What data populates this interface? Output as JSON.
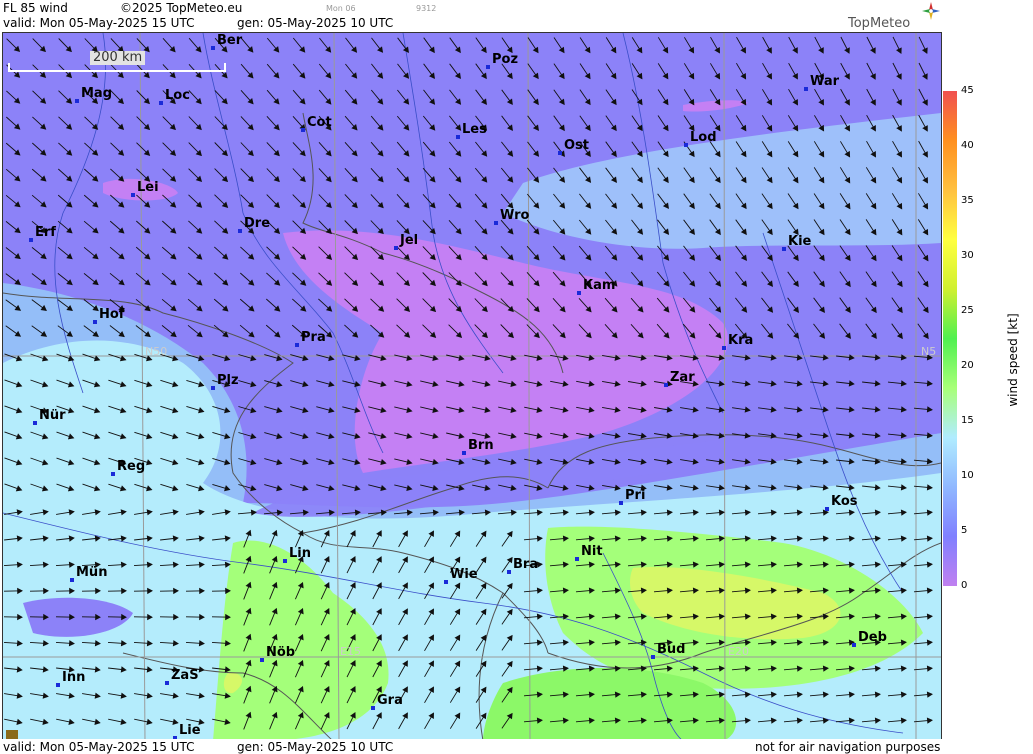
{
  "header": {
    "product": "FL 85 wind",
    "copyright": "©2025 TopMeteo.eu",
    "small_day": "Mon 06",
    "small_code": "9312",
    "valid": "valid:  Mon  05-May-2025  15 UTC",
    "gen": "gen: 05-May-2025 10 UTC",
    "logo": "TopMeteo"
  },
  "footer": {
    "valid": "valid:  Mon  05-May-2025  15 UTC",
    "gen": "gen: 05-May-2025 10 UTC",
    "disclaimer": "not for air navigation purposes"
  },
  "scale": {
    "label": "200 km"
  },
  "grid_labels": {
    "n50_left": "N50",
    "n50_right": "N5",
    "e15": "E15",
    "e20": "E20"
  },
  "legend": {
    "unit": "wind  speed  [kt]",
    "ticks": [
      "45",
      "40",
      "35",
      "30",
      "25",
      "20",
      "15",
      "10",
      "5",
      "0"
    ],
    "colors": [
      "#c080f0",
      "#8080ff",
      "#90b8ff",
      "#b0ecff",
      "#a8ff78",
      "#50f050",
      "#d0f030",
      "#ffff40",
      "#ffc040",
      "#ff9020",
      "#f05050"
    ]
  },
  "cities": [
    {
      "name": "Ber"
    },
    {
      "name": "Poz"
    },
    {
      "name": "War"
    },
    {
      "name": "Mag"
    },
    {
      "name": "Loc"
    },
    {
      "name": "Cot"
    },
    {
      "name": "Les"
    },
    {
      "name": "Ost"
    },
    {
      "name": "Lod"
    },
    {
      "name": "Lei"
    },
    {
      "name": "Dre"
    },
    {
      "name": "Wro"
    },
    {
      "name": "Erf"
    },
    {
      "name": "Jel"
    },
    {
      "name": "Kie"
    },
    {
      "name": "Kam"
    },
    {
      "name": "Hof"
    },
    {
      "name": "Pra"
    },
    {
      "name": "Kra"
    },
    {
      "name": "Plz"
    },
    {
      "name": "Zar"
    },
    {
      "name": "Nür"
    },
    {
      "name": "Brn"
    },
    {
      "name": "Reg"
    },
    {
      "name": "Pri"
    },
    {
      "name": "Kos"
    },
    {
      "name": "Lin"
    },
    {
      "name": "Nit"
    },
    {
      "name": "Wie"
    },
    {
      "name": "Bra"
    },
    {
      "name": "Mün"
    },
    {
      "name": "Deb"
    },
    {
      "name": "Nöb"
    },
    {
      "name": "Bud"
    },
    {
      "name": "Inn"
    },
    {
      "name": "ZaS"
    },
    {
      "name": "Gra"
    },
    {
      "name": "Lie"
    }
  ]
}
